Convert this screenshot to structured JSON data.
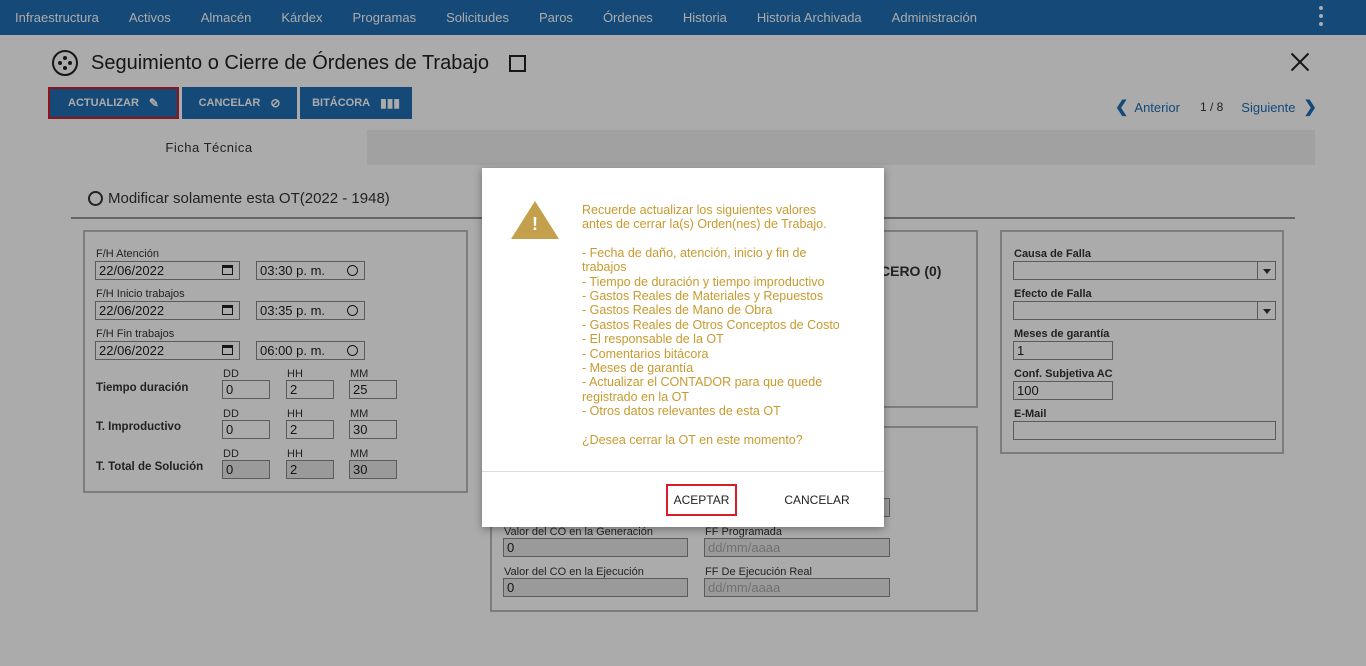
{
  "nav": {
    "items": [
      "Infraestructura",
      "Activos",
      "Almacén",
      "Kárdex",
      "Programas",
      "Solicitudes",
      "Paros",
      "Órdenes",
      "Historia",
      "Historia Archivada",
      "Administración"
    ]
  },
  "header": {
    "title": "Seguimiento o Cierre de Órdenes de Trabajo"
  },
  "toolbar": {
    "update_label": "ACTUALIZAR",
    "cancel_label": "CANCELAR",
    "log_label": "BITÁCORA"
  },
  "pager": {
    "prev_label": "Anterior",
    "position": "1 / 8",
    "next_label": "Siguiente"
  },
  "tabs": {
    "active_label": "Ficha Técnica"
  },
  "form": {
    "modify_only_label": "Modificar solamente esta OT(2022 - 1948)",
    "attention_label": "F/H Atención",
    "attention_date": "22/06/2022",
    "attention_time": "03:30 p. m.",
    "start_label": "F/H Inicio trabajos",
    "start_date": "22/06/2022",
    "start_time": "03:35 p. m.",
    "end_label": "F/H Fin trabajos",
    "end_date": "22/06/2022",
    "end_time": "06:00 p. m.",
    "dd": "DD",
    "hh": "HH",
    "mm": "MM",
    "duration_label": "Tiempo duración",
    "duration": {
      "dd": "0",
      "hh": "2",
      "mm": "25"
    },
    "unproductive_label": "T. Improductivo",
    "unproductive": {
      "dd": "0",
      "hh": "2",
      "mm": "30"
    },
    "total_label": "T. Total de Solución",
    "total": {
      "dd": "0",
      "hh": "2",
      "mm": "30"
    },
    "middle_heading_partial": "CERO (0)",
    "co_generation_label": "Valor del CO en la Generación",
    "co_generation_value": "0",
    "ff_programmed_label": "FF Programada",
    "ff_programmed_placeholder": "dd/mm/aaaa",
    "co_execution_label": "Valor del CO en la Ejecución",
    "co_execution_value": "0",
    "ff_real_label": "FF De Ejecución Real",
    "ff_real_placeholder": "dd/mm/aaaa",
    "failure_cause_label": "Causa de Falla",
    "failure_effect_label": "Efecto de Falla",
    "warranty_label": "Meses de garantía",
    "warranty_value": "1",
    "confidence_label": "Conf. Subjetiva AC",
    "confidence_value": "100",
    "email_label": "E-Mail"
  },
  "dialog": {
    "intro_line1": "Recuerde actualizar los siguientes valores",
    "intro_line2": "antes de cerrar la(s) Orden(nes) de Trabajo.",
    "items": [
      "- Fecha de daño, atención, inicio y fin de",
      "trabajos",
      "- Tiempo de duración y tiempo improductivo",
      "- Gastos Reales de Materiales y Repuestos",
      "- Gastos Reales de Mano de Obra",
      "- Gastos Reales de Otros Conceptos de Costo",
      "- El responsable de la OT",
      "- Comentarios bitácora",
      "- Meses de garantía",
      "- Actualizar el CONTADOR para que quede",
      "registrado en la OT",
      "- Otros datos relevantes de esta OT"
    ],
    "question": "¿Desea cerrar la OT en este momento?",
    "accept_label": "ACEPTAR",
    "cancel_label": "CANCELAR"
  },
  "colors": {
    "primary": "#1f6db3",
    "warning": "#c89a2e",
    "highlight": "#d21f2b"
  }
}
